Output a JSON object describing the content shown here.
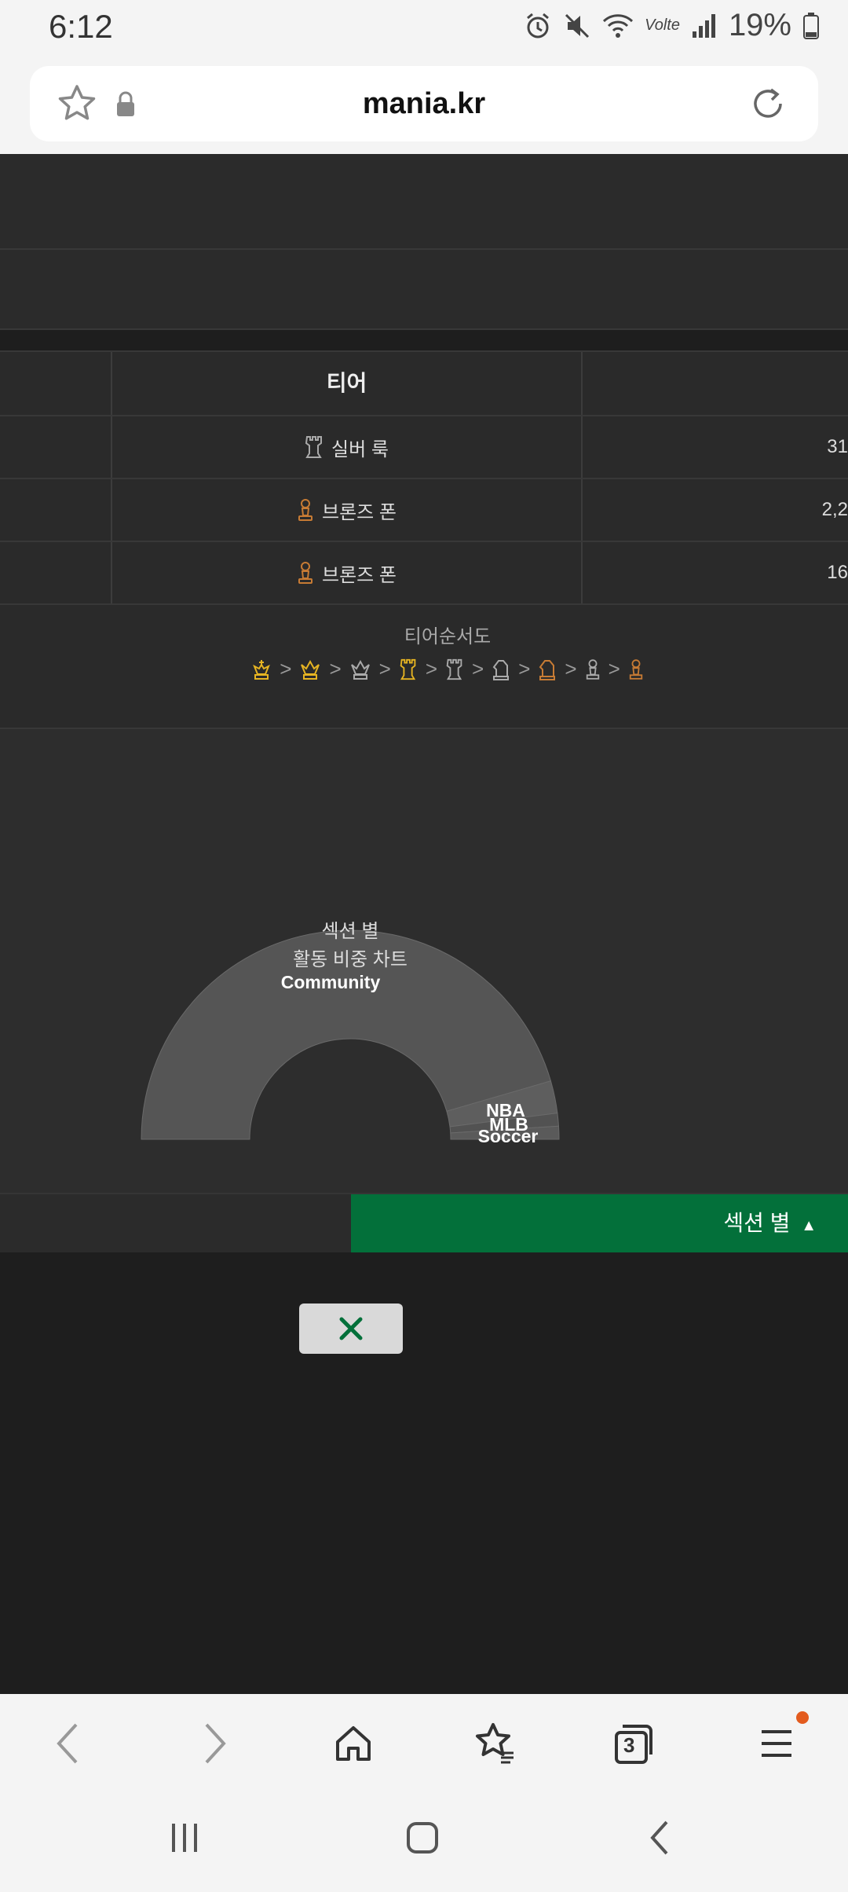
{
  "status_bar": {
    "time": "6:12",
    "battery": "19%",
    "network": "Volte"
  },
  "browser": {
    "url": "mania.kr",
    "tab_count": "3"
  },
  "table": {
    "header": "티어",
    "rows": [
      {
        "tier": "실버 룩",
        "value": "31",
        "color": "#aaaaaa"
      },
      {
        "tier": "브론즈 폰",
        "value": "2,2",
        "color": "#c77b34"
      },
      {
        "tier": "브론즈 폰",
        "value": "16",
        "color": "#c77b34"
      }
    ]
  },
  "tier_order": {
    "title": "티어순서도",
    "separator": ">"
  },
  "chart_data": {
    "type": "pie",
    "title": "섹션 별\n활동 비중 차트",
    "center_line1": "섹션 별",
    "center_line2": "활동 비중 차트",
    "slices": [
      {
        "label": "Community",
        "value": 91
      },
      {
        "label": "NBA",
        "value": 5
      },
      {
        "label": "MLB",
        "value": 2
      },
      {
        "label": "Soccer",
        "value": 2
      }
    ]
  },
  "section_toggle": {
    "label": "섹션 별"
  },
  "colors": {
    "accent": "#03703a",
    "bg": "#1e1e1e",
    "row_bg": "#2a2a2a"
  }
}
